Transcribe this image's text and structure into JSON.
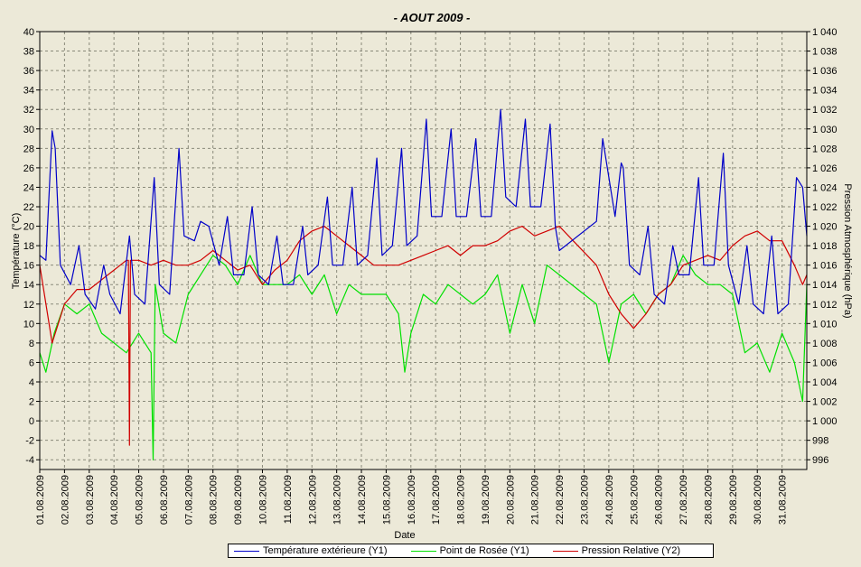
{
  "chart_data": {
    "type": "line",
    "title": "-  AOUT  2009  -",
    "xlabel": "Date",
    "ylabel": "Température (°C)",
    "y2label": "Pression Atmosphérique (hPa)",
    "ylim": [
      -5,
      40
    ],
    "y2lim": [
      995,
      1040
    ],
    "y_ticks": [
      "-4",
      "-2",
      "0",
      "2",
      "4",
      "6",
      "8",
      "10",
      "12",
      "14",
      "16",
      "18",
      "20",
      "22",
      "24",
      "26",
      "28",
      "30",
      "32",
      "34",
      "36",
      "38",
      "40"
    ],
    "y2_ticks": [
      "996",
      "998",
      "1 000",
      "1 002",
      "1 004",
      "1 006",
      "1 008",
      "1 010",
      "1 012",
      "1 014",
      "1 016",
      "1 018",
      "1 020",
      "1 022",
      "1 024",
      "1 026",
      "1 028",
      "1 030",
      "1 032",
      "1 034",
      "1 036",
      "1 038",
      "1 040"
    ],
    "x_ticks": [
      "01.08.2009",
      "02.08.2009",
      "03.08.2009",
      "04.08.2009",
      "05.08.2009",
      "06.08.2009",
      "07.08.2009",
      "08.08.2009",
      "09.08.2009",
      "10.08.2009",
      "11.08.2009",
      "12.08.2009",
      "13.08.2009",
      "14.08.2009",
      "15.08.2009",
      "16.08.2009",
      "17.08.2009",
      "18.08.2009",
      "19.08.2009",
      "20.08.2009",
      "21.08.2009",
      "22.08.2009",
      "23.08.2009",
      "24.08.2009",
      "25.08.2009",
      "26.08.2009",
      "27.08.2009",
      "28.08.2009",
      "29.08.2009",
      "30.08.2009",
      "31.08.2009"
    ],
    "grid": true,
    "legend_position": "bottom",
    "series": [
      {
        "name": "Température extérieure (Y1)",
        "axis": "y1",
        "color": "#0000c8",
        "x": [
          "01.08.2009 00:00",
          "01.08.2009 06:00",
          "01.08.2009 12:00",
          "01.08.2009 15:00",
          "01.08.2009 20:00",
          "02.08.2009 06:00",
          "02.08.2009 14:00",
          "02.08.2009 20:00",
          "03.08.2009 06:00",
          "03.08.2009 14:00",
          "03.08.2009 20:00",
          "04.08.2009 06:00",
          "04.08.2009 15:00",
          "04.08.2009 20:00",
          "05.08.2009 06:00",
          "05.08.2009 15:00",
          "05.08.2009 20:00",
          "06.08.2009 06:00",
          "06.08.2009 15:00",
          "06.08.2009 20:00",
          "07.08.2009 06:00",
          "07.08.2009 12:00",
          "07.08.2009 20:00",
          "08.08.2009 06:00",
          "08.08.2009 14:00",
          "08.08.2009 20:00",
          "09.08.2009 06:00",
          "09.08.2009 14:00",
          "09.08.2009 20:00",
          "10.08.2009 06:00",
          "10.08.2009 14:00",
          "10.08.2009 20:00",
          "11.08.2009 06:00",
          "11.08.2009 15:00",
          "11.08.2009 20:00",
          "12.08.2009 06:00",
          "12.08.2009 15:00",
          "12.08.2009 20:00",
          "13.08.2009 06:00",
          "13.08.2009 15:00",
          "13.08.2009 20:00",
          "14.08.2009 06:00",
          "14.08.2009 15:00",
          "14.08.2009 20:00",
          "15.08.2009 06:00",
          "15.08.2009 15:00",
          "15.08.2009 20:00",
          "16.08.2009 06:00",
          "16.08.2009 15:00",
          "16.08.2009 20:00",
          "17.08.2009 06:00",
          "17.08.2009 15:00",
          "17.08.2009 20:00",
          "18.08.2009 06:00",
          "18.08.2009 15:00",
          "18.08.2009 20:00",
          "19.08.2009 06:00",
          "19.08.2009 15:00",
          "19.08.2009 20:00",
          "20.08.2009 06:00",
          "20.08.2009 15:00",
          "20.08.2009 20:00",
          "21.08.2009 06:00",
          "21.08.2009 15:00",
          "21.08.2009 20:00",
          "22.08.2009 00:00",
          "23.08.2009 12:00",
          "23.08.2009 18:00",
          "24.08.2009 06:00",
          "24.08.2009 12:00",
          "24.08.2009 14:00",
          "24.08.2009 20:00",
          "25.08.2009 06:00",
          "25.08.2009 14:00",
          "25.08.2009 20:00",
          "26.08.2009 06:00",
          "26.08.2009 14:00",
          "26.08.2009 20:00",
          "27.08.2009 06:00",
          "27.08.2009 15:00",
          "27.08.2009 20:00",
          "28.08.2009 06:00",
          "28.08.2009 15:00",
          "28.08.2009 20:00",
          "29.08.2009 06:00",
          "29.08.2009 14:00",
          "29.08.2009 20:00",
          "30.08.2009 06:00",
          "30.08.2009 14:00",
          "30.08.2009 20:00",
          "31.08.2009 06:00",
          "31.08.2009 14:00",
          "31.08.2009 20:00",
          "01.09.2009 00:00"
        ],
        "y": [
          17,
          16.5,
          29.8,
          28,
          16,
          14,
          18,
          13,
          11.5,
          16,
          13,
          11,
          19,
          13,
          12,
          25,
          14,
          13,
          28,
          19,
          18.5,
          20.5,
          20,
          16,
          21,
          15,
          15,
          22,
          15,
          14,
          19,
          14,
          14,
          20,
          15,
          16,
          23,
          16,
          16,
          24,
          16,
          17,
          27,
          17,
          18,
          28,
          18,
          19,
          31,
          21,
          21,
          30,
          21,
          21,
          29,
          21,
          21,
          32,
          23,
          22,
          31,
          22,
          22,
          30.5,
          20,
          17.5,
          20.5,
          29,
          21,
          26.5,
          26,
          16,
          15,
          20,
          13,
          12,
          18,
          15,
          15,
          25,
          16,
          16,
          27.5,
          16,
          12,
          18,
          12,
          11,
          19,
          11,
          12,
          25,
          24,
          19
        ]
      },
      {
        "name": "Point de Rosée (Y1)",
        "axis": "y1",
        "color": "#00e000",
        "x": [
          "01.08.2009 00:00",
          "01.08.2009 06:00",
          "01.08.2009 14:00",
          "02.08.2009 00:00",
          "02.08.2009 12:00",
          "03.08.2009 00:00",
          "03.08.2009 12:00",
          "04.08.2009 00:00",
          "04.08.2009 12:00",
          "05.08.2009 00:00",
          "05.08.2009 12:00",
          "05.08.2009 14:00",
          "05.08.2009 16:00",
          "06.08.2009 00:00",
          "06.08.2009 12:00",
          "07.08.2009 00:00",
          "07.08.2009 12:00",
          "08.08.2009 00:00",
          "08.08.2009 12:00",
          "09.08.2009 00:00",
          "09.08.2009 12:00",
          "10.08.2009 00:00",
          "10.08.2009 12:00",
          "11.08.2009 00:00",
          "11.08.2009 12:00",
          "12.08.2009 00:00",
          "12.08.2009 12:00",
          "13.08.2009 00:00",
          "13.08.2009 12:00",
          "14.08.2009 00:00",
          "14.08.2009 12:00",
          "15.08.2009 00:00",
          "15.08.2009 12:00",
          "15.08.2009 18:00",
          "16.08.2009 00:00",
          "16.08.2009 12:00",
          "17.08.2009 00:00",
          "17.08.2009 12:00",
          "18.08.2009 00:00",
          "18.08.2009 12:00",
          "19.08.2009 00:00",
          "19.08.2009 12:00",
          "20.08.2009 00:00",
          "20.08.2009 12:00",
          "21.08.2009 00:00",
          "21.08.2009 12:00",
          "22.08.2009 00:00",
          "23.08.2009 12:00",
          "24.08.2009 00:00",
          "24.08.2009 12:00",
          "25.08.2009 00:00",
          "25.08.2009 12:00",
          "26.08.2009 00:00",
          "26.08.2009 12:00",
          "27.08.2009 00:00",
          "27.08.2009 12:00",
          "28.08.2009 00:00",
          "28.08.2009 12:00",
          "29.08.2009 00:00",
          "29.08.2009 12:00",
          "30.08.2009 00:00",
          "30.08.2009 12:00",
          "31.08.2009 00:00",
          "31.08.2009 12:00",
          "31.08.2009 20:00",
          "01.09.2009 00:00"
        ],
        "y": [
          7,
          5,
          9,
          12,
          11,
          12,
          9,
          8,
          7,
          9,
          7,
          -4,
          14,
          9,
          8,
          13,
          15,
          17,
          16,
          14,
          17,
          14,
          14,
          14,
          15,
          13,
          15,
          11,
          14,
          13,
          13,
          13,
          11,
          5,
          9,
          13,
          12,
          14,
          13,
          12,
          13,
          15,
          9,
          14,
          10,
          16,
          15,
          12,
          6,
          12,
          13,
          11,
          13,
          14,
          17,
          15,
          14,
          14,
          13,
          7,
          8,
          5,
          9,
          6,
          2,
          14
        ]
      },
      {
        "name": "Pression Relative (Y2)",
        "axis": "y2",
        "color": "#d00000",
        "x": [
          "01.08.2009 00:00",
          "01.08.2009 12:00",
          "02.08.2009 00:00",
          "02.08.2009 12:00",
          "03.08.2009 00:00",
          "03.08.2009 12:00",
          "04.08.2009 00:00",
          "04.08.2009 12:00",
          "04.08.2009 14:00",
          "04.08.2009 15:00",
          "04.08.2009 16:00",
          "05.08.2009 00:00",
          "05.08.2009 12:00",
          "06.08.2009 00:00",
          "06.08.2009 12:00",
          "07.08.2009 00:00",
          "07.08.2009 12:00",
          "08.08.2009 00:00",
          "08.08.2009 12:00",
          "09.08.2009 00:00",
          "09.08.2009 12:00",
          "10.08.2009 00:00",
          "10.08.2009 12:00",
          "11.08.2009 00:00",
          "11.08.2009 12:00",
          "12.08.2009 00:00",
          "12.08.2009 12:00",
          "13.08.2009 00:00",
          "13.08.2009 12:00",
          "14.08.2009 00:00",
          "14.08.2009 12:00",
          "15.08.2009 00:00",
          "15.08.2009 12:00",
          "16.08.2009 00:00",
          "16.08.2009 12:00",
          "17.08.2009 00:00",
          "17.08.2009 12:00",
          "18.08.2009 00:00",
          "18.08.2009 12:00",
          "19.08.2009 00:00",
          "19.08.2009 12:00",
          "20.08.2009 00:00",
          "20.08.2009 12:00",
          "21.08.2009 00:00",
          "21.08.2009 12:00",
          "22.08.2009 00:00",
          "23.08.2009 12:00",
          "24.08.2009 00:00",
          "24.08.2009 12:00",
          "25.08.2009 00:00",
          "25.08.2009 12:00",
          "26.08.2009 00:00",
          "26.08.2009 12:00",
          "27.08.2009 00:00",
          "27.08.2009 12:00",
          "28.08.2009 00:00",
          "28.08.2009 12:00",
          "29.08.2009 00:00",
          "29.08.2009 12:00",
          "30.08.2009 00:00",
          "30.08.2009 12:00",
          "31.08.2009 00:00",
          "31.08.2009 12:00",
          "31.08.2009 20:00",
          "01.09.2009 00:00"
        ],
        "y": [
          1016,
          1008,
          1012,
          1013.5,
          1013.5,
          1014.5,
          1015.5,
          1016.5,
          1016.5,
          997.5,
          1016.5,
          1016.5,
          1016,
          1016.5,
          1016,
          1016,
          1016.5,
          1017.5,
          1016.5,
          1015.5,
          1016,
          1014,
          1015.5,
          1016.5,
          1018.5,
          1019.5,
          1020,
          1019,
          1018,
          1017,
          1016,
          1016,
          1016,
          1016.5,
          1017,
          1017.5,
          1018,
          1017,
          1018,
          1018,
          1018.5,
          1019.5,
          1020,
          1019,
          1019.5,
          1020,
          1016,
          1013,
          1011,
          1009.5,
          1011,
          1013,
          1014,
          1016,
          1016.5,
          1017,
          1016.5,
          1018,
          1019,
          1019.5,
          1018.5,
          1018.5,
          1016,
          1014,
          1015
        ]
      }
    ]
  }
}
